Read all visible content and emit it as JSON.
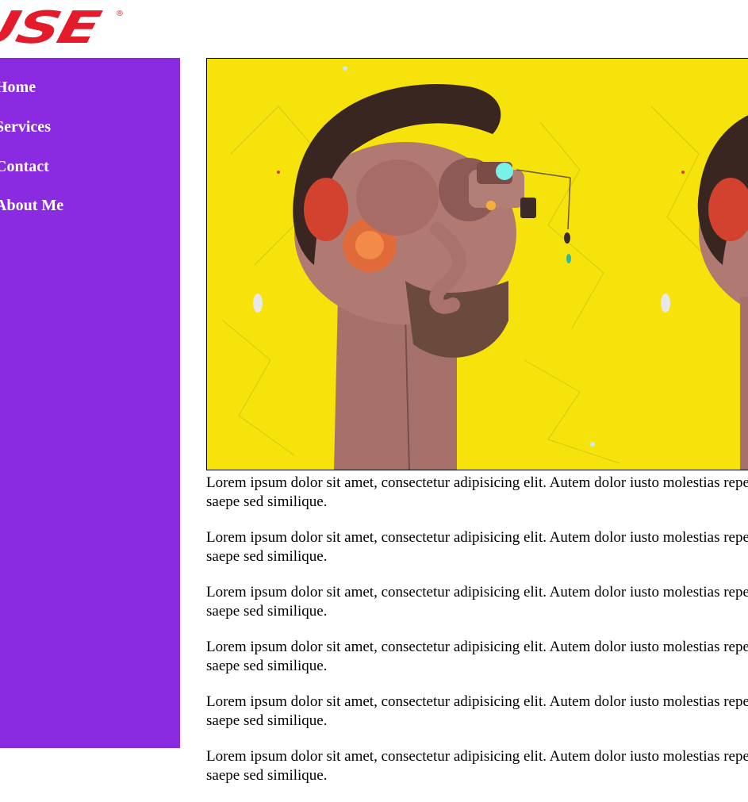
{
  "header": {
    "logo_text": "USE",
    "logo_reg": "®"
  },
  "colors": {
    "sidebar": "#8a2be2",
    "logo": "#e31b2b",
    "hero_bg": "#f5e30b"
  },
  "sidebar": {
    "items": [
      {
        "label": "Home"
      },
      {
        "label": "Services"
      },
      {
        "label": "Contact"
      },
      {
        "label": "About Me"
      }
    ]
  },
  "main": {
    "hero_image": "robot-head-illustration",
    "paragraphs": [
      "Lorem ipsum dolor sit amet, consectetur adipisicing elit. Autem dolor iusto molestias repellat, saepe sed similique.",
      "Lorem ipsum dolor sit amet, consectetur adipisicing elit. Autem dolor iusto molestias repellat, saepe sed similique.",
      "Lorem ipsum dolor sit amet, consectetur adipisicing elit. Autem dolor iusto molestias repellat, saepe sed similique.",
      "Lorem ipsum dolor sit amet, consectetur adipisicing elit. Autem dolor iusto molestias repellat, saepe sed similique.",
      "Lorem ipsum dolor sit amet, consectetur adipisicing elit. Autem dolor iusto molestias repellat, saepe sed similique.",
      "Lorem ipsum dolor sit amet, consectetur adipisicing elit. Autem dolor iusto molestias repellat, saepe sed similique."
    ]
  }
}
